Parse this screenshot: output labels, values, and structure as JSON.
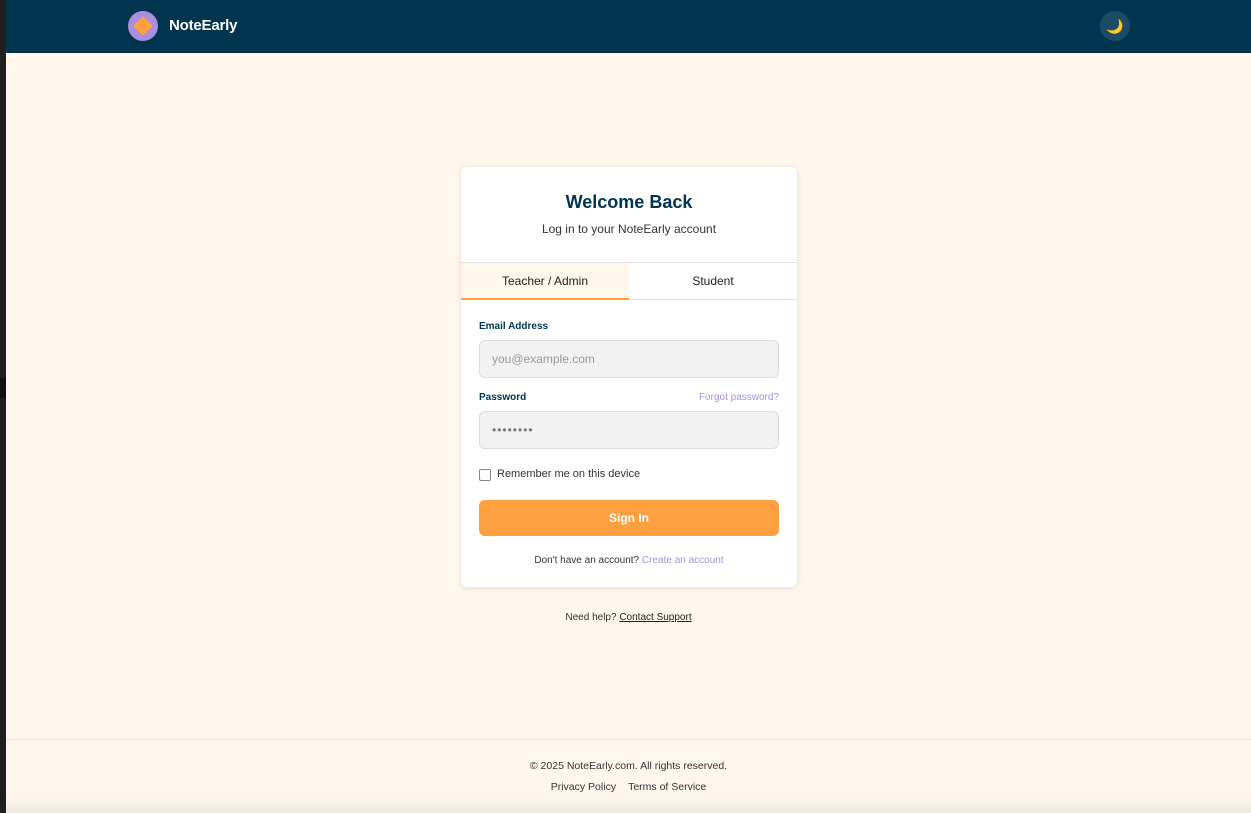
{
  "header": {
    "brand": "NoteEarly",
    "theme_toggle_icon": "moon-icon"
  },
  "login": {
    "title": "Welcome Back",
    "subtitle": "Log in to your NoteEarly account",
    "tabs": [
      {
        "label": "Teacher / Admin",
        "active": true
      },
      {
        "label": "Student",
        "active": false
      }
    ],
    "email_label": "Email Address",
    "email_placeholder": "you@example.com",
    "password_label": "Password",
    "forgot_link": "Forgot password?",
    "password_value": "••••••••",
    "remember_label": "Remember me on this device",
    "remember_checked": false,
    "signin_label": "Sign In",
    "signup_prompt": "Don't have an account?",
    "signup_link": "Create an account"
  },
  "help": {
    "prompt": "Need help?",
    "link": "Contact Support"
  },
  "footer": {
    "copyright": "© 2025 NoteEarly.com. All rights reserved.",
    "links": [
      "Privacy Policy",
      "Terms of Service"
    ]
  },
  "colors": {
    "header_bg": "#00344f",
    "page_bg": "#fff7ec",
    "accent": "#ffa040",
    "link": "#a98fdb"
  }
}
